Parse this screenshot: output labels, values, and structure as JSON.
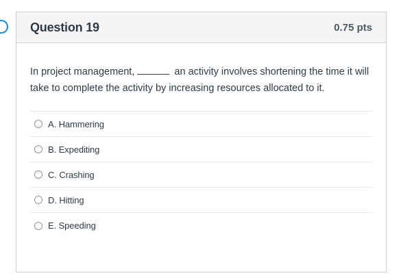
{
  "question": {
    "title": "Question 19",
    "points": "0.75 pts",
    "text_before_blank": "In project management,",
    "text_after_blank": "an activity involves shortening the time it will take to complete the activity by increasing resources allocated to it."
  },
  "answers": [
    {
      "label": "A. Hammering"
    },
    {
      "label": "B. Expediting"
    },
    {
      "label": "C. Crashing"
    },
    {
      "label": "D. Hitting"
    },
    {
      "label": "E. Speeding"
    }
  ]
}
